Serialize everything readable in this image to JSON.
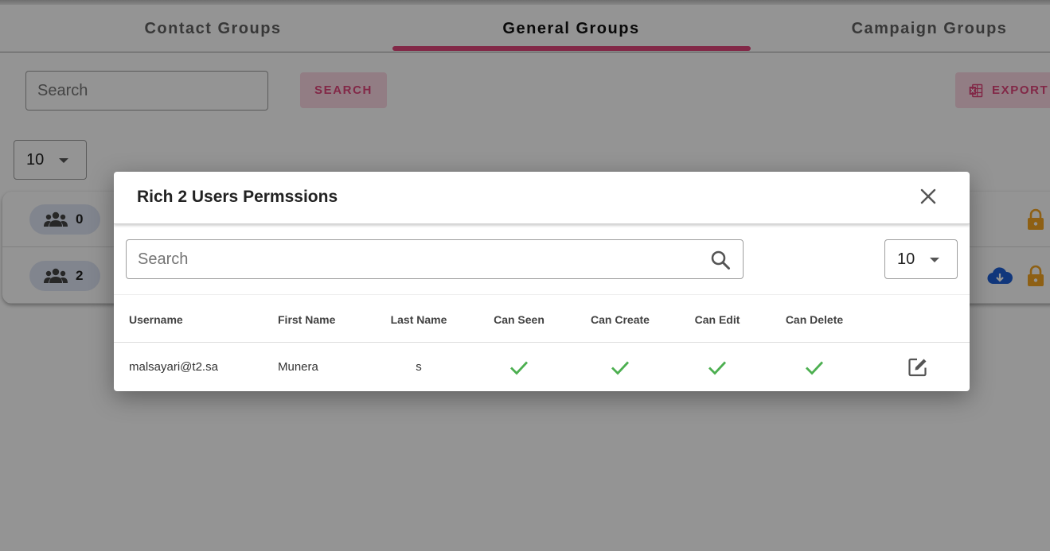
{
  "tabs": [
    {
      "label": "Contact Groups",
      "active": false
    },
    {
      "label": "General Groups",
      "active": true
    },
    {
      "label": "Campaign Groups",
      "active": false
    }
  ],
  "background": {
    "search_placeholder": "Search",
    "search_button": "SEARCH",
    "export_button": "EXPORT",
    "per_page": "10",
    "rows": [
      {
        "members": "0"
      },
      {
        "members": "2"
      }
    ]
  },
  "modal": {
    "title": "Rich 2 Users Permssions",
    "search_placeholder": "Search",
    "per_page": "10",
    "columns": [
      "Username",
      "First Name",
      "Last Name",
      "Can Seen",
      "Can Create",
      "Can Edit",
      "Can Delete"
    ],
    "rows": [
      {
        "username": "malsayari@t2.sa",
        "first_name": "Munera",
        "last_name": "s",
        "can_seen": true,
        "can_create": true,
        "can_edit": true,
        "can_delete": true
      }
    ]
  },
  "colors": {
    "accent": "#e0457b",
    "check": "#4caf50",
    "lock": "#f5a623",
    "cloud": "#1e5fd6"
  },
  "icons": {
    "close": "close-icon",
    "search": "search-icon",
    "edit": "edit-icon",
    "check": "check-icon",
    "group": "group-icon",
    "lock": "lock-icon",
    "download": "cloud-download-icon",
    "excel": "excel-icon"
  }
}
